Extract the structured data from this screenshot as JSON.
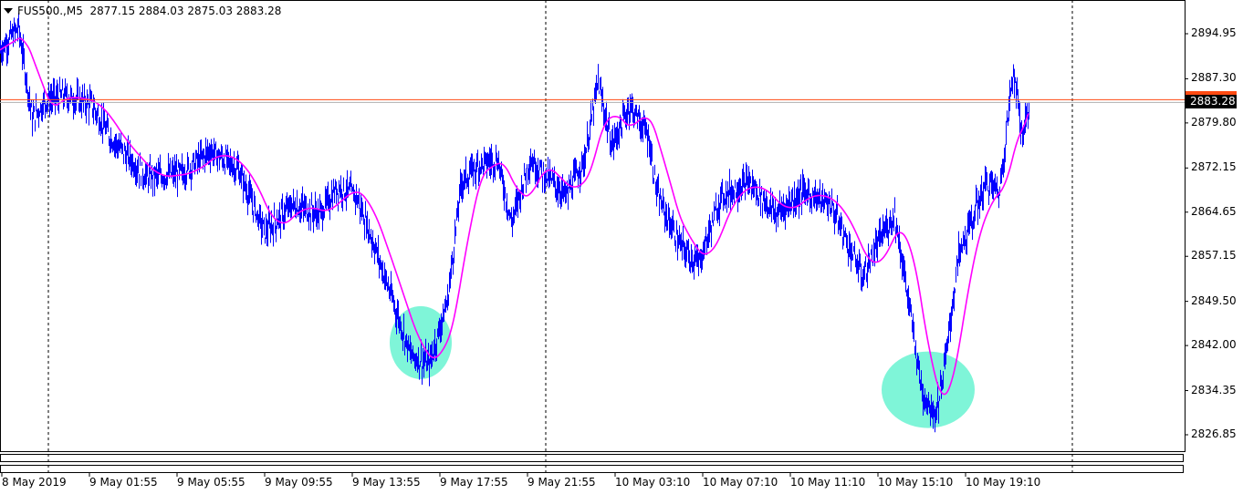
{
  "header": {
    "symbol": "FUS500.,M5",
    "ohlc": "2877.15 2884.03 2875.03 2883.28"
  },
  "price_axis": {
    "labels": [
      "2894.95",
      "2887.30",
      "2879.80",
      "2872.15",
      "2864.65",
      "2857.15",
      "2849.50",
      "2842.00",
      "2834.35",
      "2826.85"
    ],
    "current_price": "2883.28"
  },
  "time_axis": {
    "labels": [
      "8 May 2019",
      "9 May 01:55",
      "9 May 05:55",
      "9 May 09:55",
      "9 May 13:55",
      "9 May 17:55",
      "9 May 21:55",
      "10 May 03:10",
      "10 May 07:10",
      "10 May 11:10",
      "10 May 15:10",
      "10 May 19:10"
    ]
  },
  "colors": {
    "price": "#0000ff",
    "ma": "#ff00ff",
    "highlight": "#7ff5d8",
    "ask_line": "#ff4a12",
    "bid_line": "#b0b0b0"
  },
  "chart_data": {
    "type": "line",
    "title": "FUS500.,M5",
    "ylim": [
      2825.0,
      2898.0
    ],
    "price_path": [
      [
        0,
        2892.2
      ],
      [
        20,
        2896
      ],
      [
        35,
        2880.6
      ],
      [
        50,
        2883.7
      ],
      [
        70,
        2884.4
      ],
      [
        100,
        2882.9
      ],
      [
        120,
        2877.5
      ],
      [
        160,
        2870.5
      ],
      [
        200,
        2871.3
      ],
      [
        230,
        2875.1
      ],
      [
        260,
        2872.0
      ],
      [
        290,
        2861.2
      ],
      [
        320,
        2865.9
      ],
      [
        350,
        2864.3
      ],
      [
        370,
        2868.9
      ],
      [
        390,
        2867.4
      ],
      [
        410,
        2858.9
      ],
      [
        430,
        2849.6
      ],
      [
        450,
        2840.3
      ],
      [
        470,
        2838.8
      ],
      [
        490,
        2849.6
      ],
      [
        505,
        2869.7
      ],
      [
        525,
        2872.8
      ],
      [
        545,
        2873.6
      ],
      [
        560,
        2862.8
      ],
      [
        580,
        2873.6
      ],
      [
        600,
        2870.5
      ],
      [
        620,
        2867.4
      ],
      [
        640,
        2873.6
      ],
      [
        655,
        2886.7
      ],
      [
        670,
        2875.9
      ],
      [
        690,
        2882.9
      ],
      [
        710,
        2877.5
      ],
      [
        720,
        2867.4
      ],
      [
        745,
        2858.9
      ],
      [
        765,
        2855.8
      ],
      [
        790,
        2867.4
      ],
      [
        820,
        2869.7
      ],
      [
        850,
        2864.3
      ],
      [
        880,
        2868.2
      ],
      [
        910,
        2865.9
      ],
      [
        930,
        2858.9
      ],
      [
        945,
        2853.5
      ],
      [
        965,
        2860.5
      ],
      [
        980,
        2864.3
      ],
      [
        995,
        2849.6
      ],
      [
        1010,
        2834.1
      ],
      [
        1025,
        2830.3
      ],
      [
        1035,
        2838.8
      ],
      [
        1050,
        2857.3
      ],
      [
        1080,
        2869.7
      ],
      [
        1095,
        2868.2
      ],
      [
        1110,
        2889.1
      ],
      [
        1120,
        2877.5
      ],
      [
        1127,
        2883.3
      ]
    ],
    "ma_period": 30,
    "highlights": [
      {
        "bar": 461,
        "price": 2842.5
      },
      {
        "bar": 1017,
        "price": 2834.5
      }
    ]
  }
}
